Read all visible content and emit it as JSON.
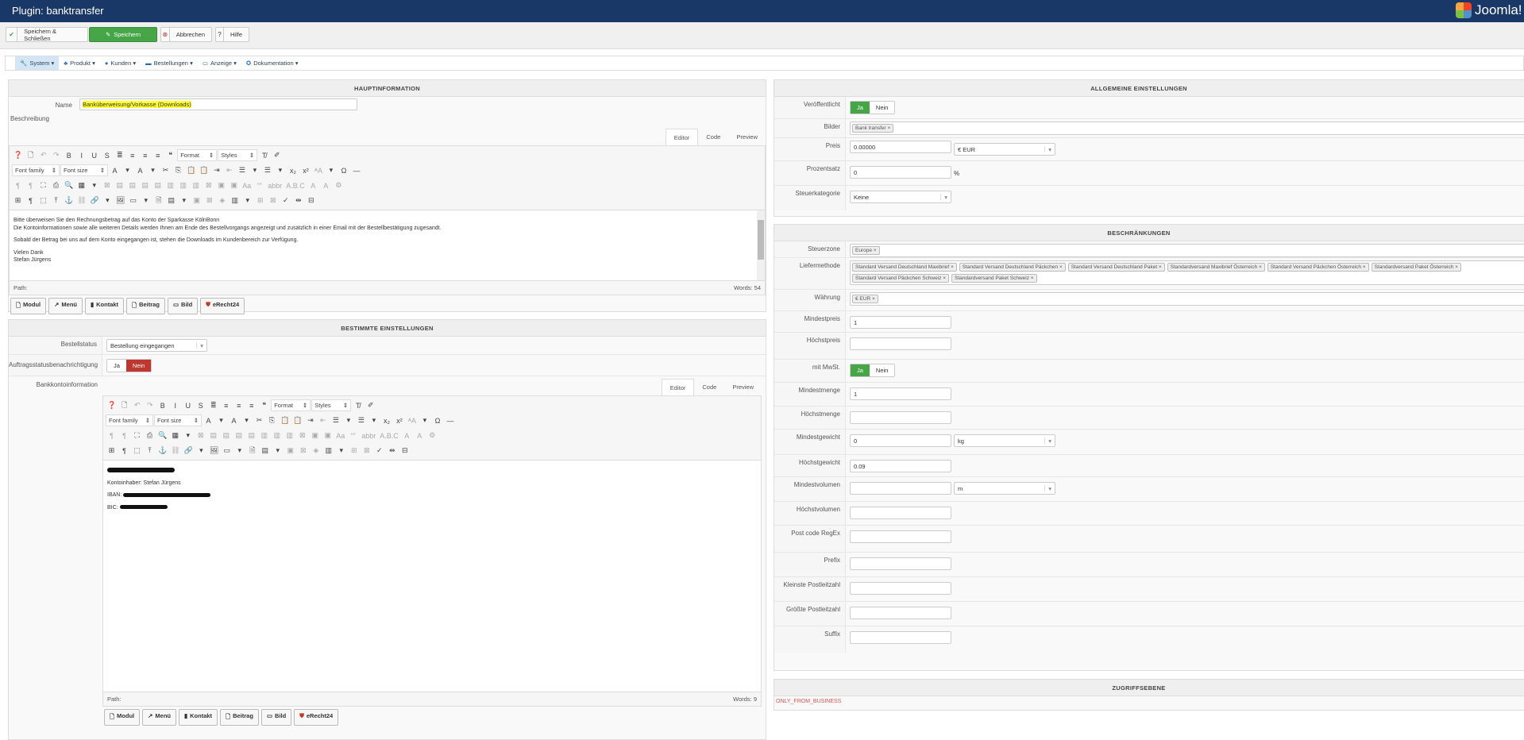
{
  "title": "Plugin: banktransfer",
  "logo_text": "Joomla!",
  "toolbar": {
    "save_close": "Speichern & Schließen",
    "save": "Speichern",
    "cancel": "Abbrechen",
    "help": "Hilfe"
  },
  "nav": [
    "System",
    "Produkt",
    "Kunden",
    "Bestellungen",
    "Anzeige",
    "Dokumentation"
  ],
  "main": {
    "header": "HAUPTINFORMATION",
    "name_label": "Name",
    "name_value": "Banküberweisung/Vorkasse (Downloads)",
    "desc_label": "Beschreibung",
    "tabs": [
      "Editor",
      "Code",
      "Preview"
    ],
    "content": [
      "Bitte überweisen Sie den Rechnungsbetrag auf das Konto der Sparkasse KölnBonn",
      "Die Kontoinformationen sowie alle weiteren Details werden Ihnen am Ende des Bestellvorgangs angezeigt und zusätzlich in einer Email mit der Bestellbestätigung zugesandt.",
      "Sobald der Betrag bei uns auf dem Konto eingegangen ist, stehen die Downloads im Kundenbereich zur Verfügung.",
      "Vielen Dank",
      "Stefan Jürgens"
    ],
    "path": "Path:",
    "words": "Words: 54"
  },
  "editor": {
    "format": "Format",
    "styles": "Styles",
    "font_family": "Font family",
    "font_size": "Font size",
    "buttons": [
      "Modul",
      "Menü",
      "Kontakt",
      "Beitrag",
      "Bild",
      "eRecht24"
    ]
  },
  "specific": {
    "header": "BESTIMMTE EINSTELLUNGEN",
    "order_status_label": "Bestellstatus",
    "order_status": "Bestellung eingegangen",
    "notify_label": "Auftragsstatusbenachrichtigung",
    "yes": "Ja",
    "no": "Nein",
    "bank_label": "Bankkontoinformation",
    "account_holder": "Kontoinhaber: Stefan Jürgens",
    "iban": "IBAN:",
    "bic": "BIC:",
    "path": "Path:",
    "words": "Words: 9"
  },
  "general": {
    "header": "ALLGEMEINE EINSTELLUNGEN",
    "published_label": "Veröffentlicht",
    "yes": "Ja",
    "no": "Nein",
    "images_label": "Bilder",
    "image_tag": "Bank transfer",
    "price_label": "Preis",
    "price": "0.00000",
    "currency": "€ EUR",
    "percent_label": "Prozentsatz",
    "percent": "0",
    "percent_unit": "%",
    "tax_label": "Steuerkategorie",
    "tax": "Keine"
  },
  "restrictions": {
    "header": "BESCHRÄNKUNGEN",
    "zone_label": "Steuerzone",
    "zones": [
      "Europe"
    ],
    "shipping_label": "Liefermethode",
    "shipping": [
      "Standard Versand Deutschland Maxibrief",
      "Standard Versand Deutschland Päckchen",
      "Standard Versand Deutschland Paket",
      "Standardversand Maxibrief Österreich",
      "Standard Versand Päckchen Österreich",
      "Standardversand Paket Österreich",
      "Standard Versand Päckchen Schweiz",
      "Standardversand Paket Schweiz"
    ],
    "currency_label": "Währung",
    "currencies": [
      "€ EUR"
    ],
    "min_price_label": "Mindestpreis",
    "min_price": "1",
    "max_price_label": "Höchstpreis",
    "max_price": "",
    "vat_label": "mit MwSt.",
    "yes": "Ja",
    "no": "Nein",
    "min_qty_label": "Mindestmenge",
    "min_qty": "1",
    "max_qty_label": "Höchstmenge",
    "max_qty": "",
    "min_weight_label": "Mindestgewicht",
    "min_weight": "0",
    "weight_unit": "kg",
    "max_weight_label": "Höchstgewicht",
    "max_weight": "0.09",
    "min_vol_label": "Mindestvolumen",
    "min_vol": "",
    "vol_unit": "m",
    "max_vol_label": "Höchstvolumen",
    "max_vol": "",
    "postcode_label": "Post code RegEx",
    "postcode": "",
    "prefix_label": "Prefix",
    "prefix": "",
    "min_zip_label": "Kleinste Postleitzahl",
    "min_zip": "",
    "max_zip_label": "Größte Postleitzahl",
    "max_zip": "",
    "suffix_label": "Suffix",
    "suffix": ""
  },
  "access": {
    "header": "ZUGRIFFSEBENE",
    "value": "ONLY_FROM_BUSINESS",
    "value_color": "#d9534f"
  }
}
